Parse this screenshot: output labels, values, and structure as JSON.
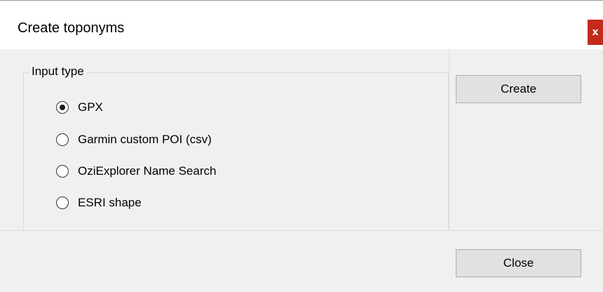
{
  "window": {
    "title": "Create toponyms",
    "close_glyph": "x",
    "close_color": "#c42b1c"
  },
  "input_type": {
    "legend": "Input type",
    "options": [
      {
        "label": "GPX",
        "selected": true
      },
      {
        "label": "Garmin custom POI (csv)",
        "selected": false
      },
      {
        "label": "OziExplorer Name Search",
        "selected": false
      },
      {
        "label": "ESRI shape",
        "selected": false
      }
    ]
  },
  "buttons": {
    "create": "Create",
    "close": "Close"
  }
}
